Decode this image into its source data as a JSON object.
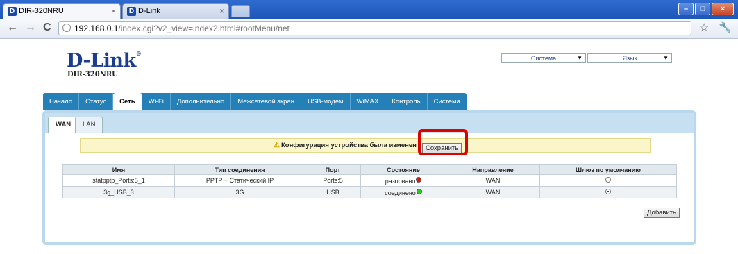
{
  "browser": {
    "tabs": [
      {
        "title": "DIR-320NRU",
        "close": "×"
      },
      {
        "title": "D-Link",
        "close": "×"
      }
    ],
    "favicon": "D",
    "url_host": "192.168.0.1",
    "url_path": "/index.cgi?v2_view=index2.html#rootMenu/net",
    "window_buttons": {
      "min": "–",
      "max": "□",
      "close": "×"
    }
  },
  "header": {
    "logo": "D-Link",
    "logo_reg": "®",
    "model": "DIR-320NRU",
    "system_select": "Система",
    "language_select": "Язык"
  },
  "mainnav": [
    "Начало",
    "Статус",
    "Сеть",
    "Wi-Fi",
    "Дополнительно",
    "Межсетевой экран",
    "USB-модем",
    "WiMAX",
    "Контроль",
    "Система"
  ],
  "mainnav_active": "Сеть",
  "subnav": [
    "WAN",
    "LAN"
  ],
  "notice": {
    "text": "Конфигурация устройства была изменен",
    "save_label": "Сохранить"
  },
  "table": {
    "headers": [
      "Имя",
      "Тип соединения",
      "Порт",
      "Состояние",
      "Направление",
      "Шлюз по умолчанию"
    ],
    "rows": [
      {
        "name": "statpptp_Ports:5_1",
        "type": "PPTP + Статический IP",
        "port": "Ports:5",
        "state": "разорвано",
        "state_color": "#e01515",
        "direction": "WAN",
        "default": false
      },
      {
        "name": "3g_USB_3",
        "type": "3G",
        "port": "USB",
        "state": "соединено",
        "state_color": "#2ec82e",
        "direction": "WAN",
        "default": true
      }
    ]
  },
  "add_label": "Добавить",
  "colors": {
    "nav": "#2580b8",
    "brand": "#1b3d8f",
    "highlight": "#e00000"
  }
}
